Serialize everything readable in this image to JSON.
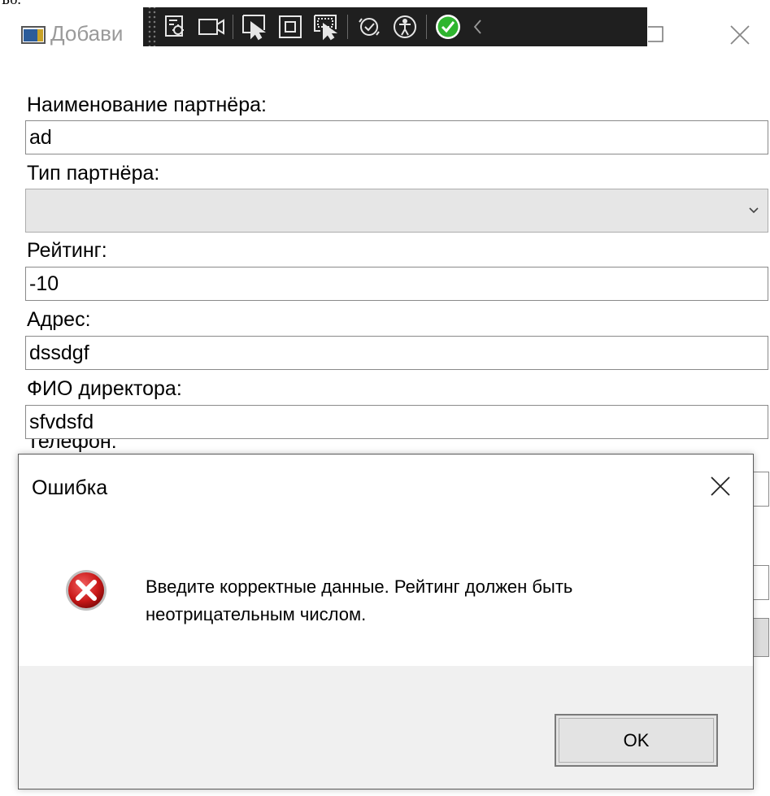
{
  "window": {
    "title": "Добави",
    "title_top_fragment": "Бо."
  },
  "toolbar": {
    "buttons": [
      {
        "icon": "live-visual-tree-icon"
      },
      {
        "icon": "record-icon"
      },
      {
        "icon": "select-element-icon"
      },
      {
        "icon": "display-layout-adorners-icon"
      },
      {
        "icon": "track-focused-element-icon"
      },
      {
        "icon": "hot-reload-icon"
      },
      {
        "icon": "accessibility-icon"
      },
      {
        "icon": "check-icon"
      },
      {
        "icon": "collapse-chevron-icon"
      }
    ]
  },
  "form": {
    "name_label": "Наименование партнёра:",
    "name_value": "ad",
    "type_label": "Тип партнёра:",
    "type_value": "",
    "rating_label": "Рейтинг:",
    "rating_value": "-10",
    "address_label": "Адрес:",
    "address_value": "dssdgf",
    "director_label": "ФИО директора:",
    "director_value": "sfvdsfd",
    "phone_label_fragment": "Телефон:"
  },
  "dialog": {
    "title": "Ошибка",
    "message": "Введите корректные данные. Рейтинг должен быть неотрицательным числом.",
    "ok_label": "OK"
  },
  "colors": {
    "toolbar_bg": "#1f1f1f",
    "check_green": "#2fb52f",
    "error_red": "#d42020",
    "footer_bg": "#f0f0f0"
  }
}
